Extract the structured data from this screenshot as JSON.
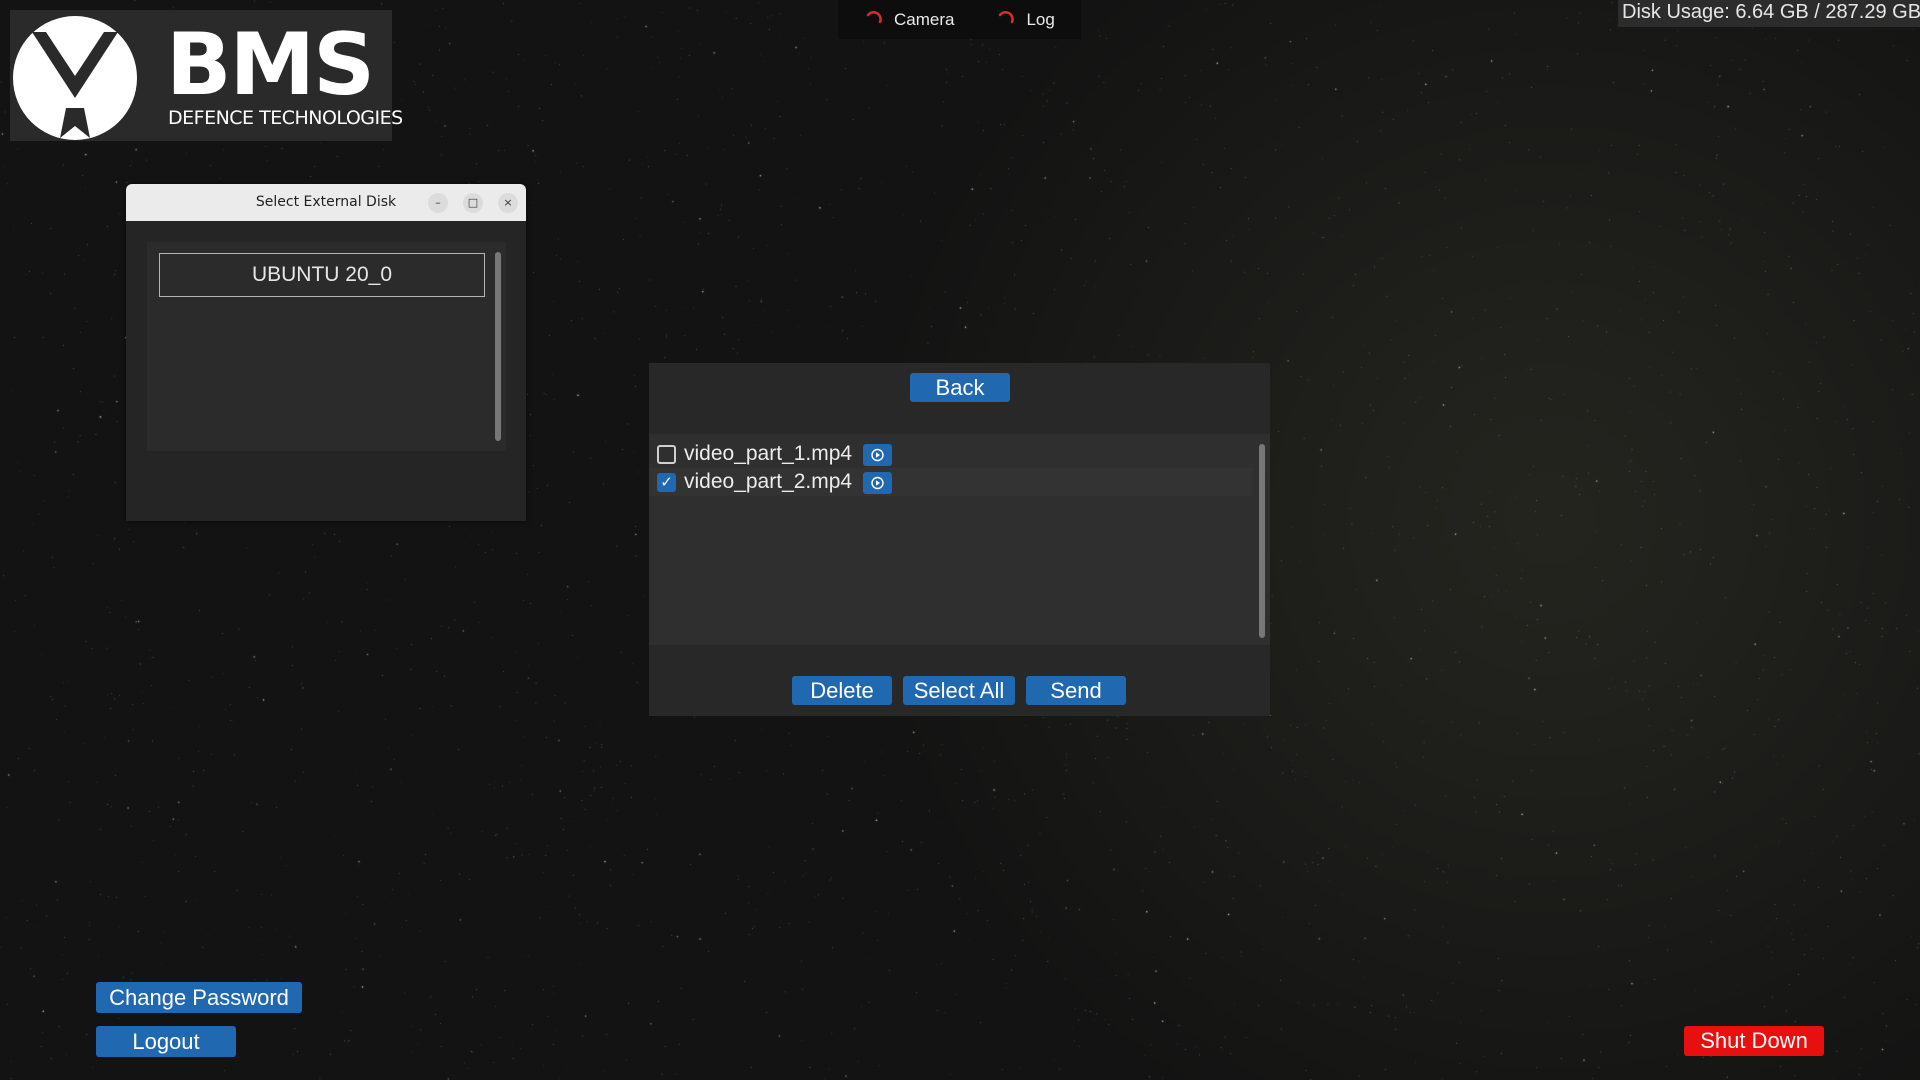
{
  "logo": {
    "brand": "BMS",
    "subtitle": "DEFENCE TECHNOLOGIES"
  },
  "top_tabs": [
    {
      "label": "Camera",
      "icon": "loading-spinner-icon"
    },
    {
      "label": "Log",
      "icon": "loading-spinner-icon"
    }
  ],
  "disk_usage": "Disk Usage: 6.64 GB / 287.29 GB",
  "disk_dialog": {
    "title": "Select External Disk",
    "controls": {
      "minimize": "–",
      "maximize": "□",
      "close": "×"
    },
    "disks": [
      "UBUNTU 20_0"
    ]
  },
  "file_panel": {
    "back_label": "Back",
    "files": [
      {
        "name": "video_part_1.mp4",
        "checked": false
      },
      {
        "name": "video_part_2.mp4",
        "checked": true
      }
    ],
    "checkmark": "✓",
    "delete_label": "Delete",
    "select_all_label": "Select All",
    "send_label": "Send"
  },
  "bottom": {
    "change_password_label": "Change Password",
    "logout_label": "Logout",
    "shutdown_label": "Shut Down"
  },
  "colors": {
    "button_blue": "#2068b0",
    "shutdown_red": "#e80f0f",
    "spinner_red": "#e0282a",
    "background": "#141414"
  }
}
